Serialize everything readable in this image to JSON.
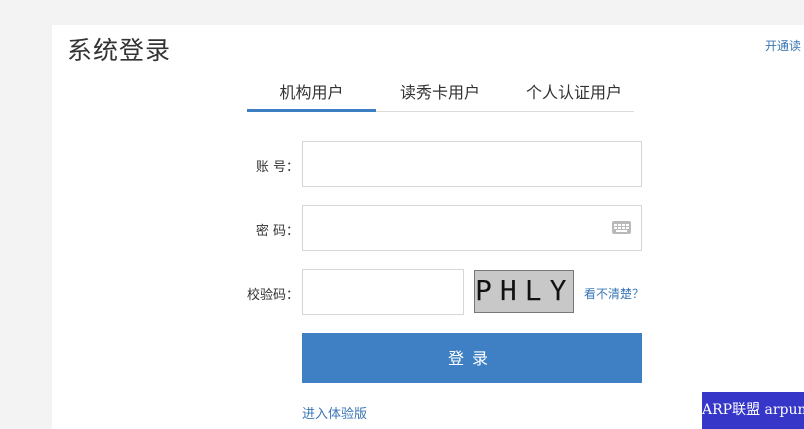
{
  "header": {
    "title": "系统登录",
    "top_link": "开通读"
  },
  "tabs": [
    {
      "label": "机构用户",
      "active": true
    },
    {
      "label": "读秀卡用户",
      "active": false
    },
    {
      "label": "个人认证用户",
      "active": false
    }
  ],
  "form": {
    "account_label": "账 号：",
    "account_value": "",
    "password_label": "密 码：",
    "password_value": "",
    "captcha_label": "校验码：",
    "captcha_value": "",
    "captcha_text": "PHLY",
    "captcha_hint": "看不清楚？",
    "login_label": "登录",
    "trial_link": "进入体验版"
  },
  "watermark": "ARP联盟 arpun.com",
  "colors": {
    "accent": "#3e80c3",
    "link": "#3a76b4",
    "background": "#f3f3f3"
  }
}
